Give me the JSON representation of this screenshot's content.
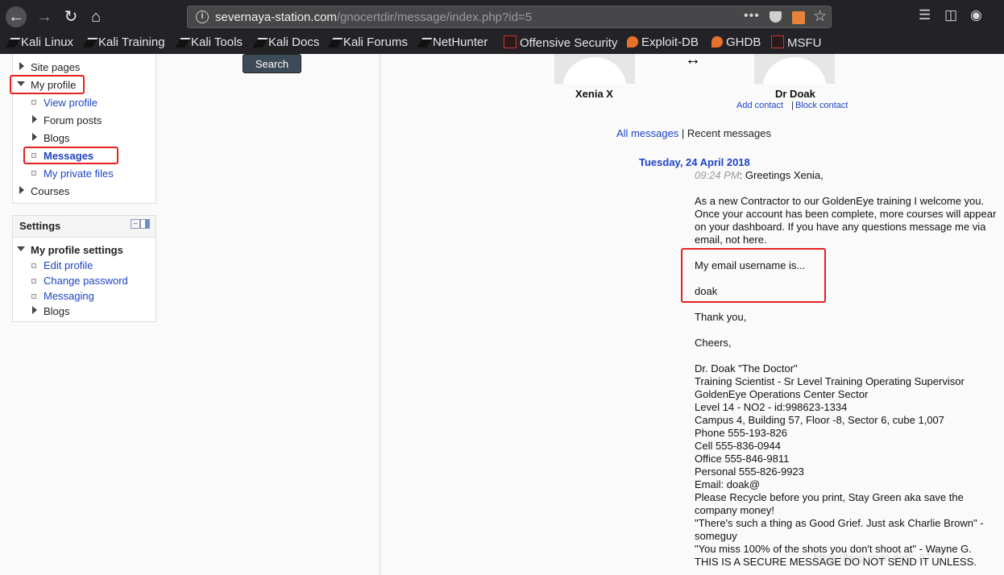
{
  "browser": {
    "url_host": "severnaya-station.com",
    "url_path": "/gnocertdir/message/index.php?id=5",
    "more_label": "•••",
    "bookmarks": [
      {
        "label": "Kali Linux",
        "icon": "kali-dragon-icon"
      },
      {
        "label": "Kali Training",
        "icon": "kali-dragon-icon"
      },
      {
        "label": "Kali Tools",
        "icon": "kali-dragon-icon"
      },
      {
        "label": "Kali Docs",
        "icon": "kali-dragon-icon"
      },
      {
        "label": "Kali Forums",
        "icon": "kali-dragon-icon"
      },
      {
        "label": "NetHunter",
        "icon": "kali-dragon-icon"
      },
      {
        "label": "Offensive Security",
        "icon": "offsec-icon"
      },
      {
        "label": "Exploit-DB",
        "icon": "exploitdb-icon"
      },
      {
        "label": "GHDB",
        "icon": "exploitdb-icon"
      },
      {
        "label": "MSFU",
        "icon": "offsec-icon"
      }
    ]
  },
  "navigation": {
    "items": {
      "site_pages": "Site pages",
      "my_profile": "My profile",
      "view_profile": "View profile",
      "forum_posts": "Forum posts",
      "blogs": "Blogs",
      "messages": "Messages",
      "private_files": "My private files",
      "courses": "Courses"
    }
  },
  "settings": {
    "title": "Settings",
    "collapse_symbol": "–",
    "section": "My profile settings",
    "items": {
      "edit_profile": "Edit profile",
      "change_password": "Change password",
      "messaging": "Messaging",
      "blogs": "Blogs"
    }
  },
  "search_button": "Search",
  "contacts": {
    "user_name": "Xenia X",
    "other_name": "Dr Doak",
    "add_contact": "Add contact",
    "separator": "|",
    "block_contact": "Block contact"
  },
  "message_tabs": {
    "all": "All messages",
    "separator": " | ",
    "recent": "Recent messages"
  },
  "message": {
    "date": "Tuesday, 24 April 2018",
    "time": "09:24 PM",
    "greeting": ": Greetings Xenia,",
    "lines": [
      "As a new Contractor to our GoldenEye training I welcome you.",
      "Once your account has been complete, more courses will appear",
      "on your dashboard. If you have any questions message me via",
      "email, not here.",
      "My email username is...",
      "doak",
      "Thank you,",
      "Cheers,",
      "Dr. Doak \"The Doctor\"",
      "Training Scientist - Sr Level Training Operating Supervisor",
      "GoldenEye Operations Center Sector",
      "Level 14 - NO2 - id:998623-1334",
      "Campus 4, Building 57, Floor -8, Sector 6, cube 1,007",
      "Phone 555-193-826",
      "Cell 555-836-0944",
      "Office 555-846-9811",
      "Personal 555-826-9923",
      "Email: doak@",
      "Please Recycle before you print, Stay Green aka save the",
      "company money!",
      "\"There's such a thing as Good Grief. Just ask Charlie Brown\" -",
      "someguy",
      "\"You miss 100% of the shots you don't shoot at\" - Wayne G.",
      "THIS IS A SECURE MESSAGE DO NOT SEND IT UNLESS."
    ]
  },
  "watermark": "https://blog.csdn.net/...07"
}
